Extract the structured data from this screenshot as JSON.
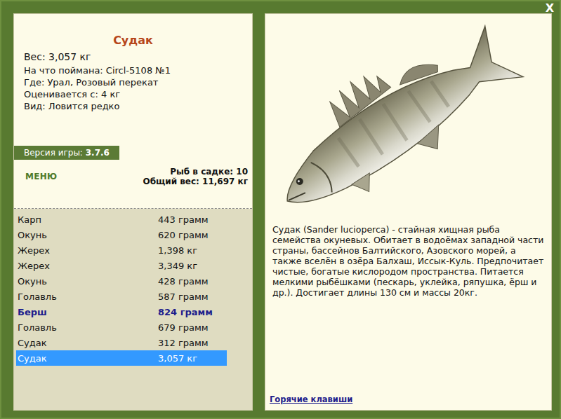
{
  "window": {
    "close": "X"
  },
  "fish": {
    "title": "Судак",
    "info": [
      "Вес: 3,057 кг",
      "На что поймана: Circl-5108 №1",
      "Где: Урал, Розовый перекат",
      "Оценивается с: 4 кг",
      "Вид: Ловится редко"
    ]
  },
  "version": {
    "label": "Версия игры: ",
    "value": "3.7.6"
  },
  "menu": "МЕНЮ",
  "summary": [
    "Рыб в садке: 10",
    "Общий вес: 11,697 кг"
  ],
  "catch": [
    {
      "name": "Карп",
      "weight": "443 грамм",
      "highlighted": false,
      "selected": false
    },
    {
      "name": "Окунь",
      "weight": "620 грамм",
      "highlighted": false,
      "selected": false
    },
    {
      "name": "Жерех",
      "weight": "1,398 кг",
      "highlighted": false,
      "selected": false
    },
    {
      "name": "Жерех",
      "weight": "3,349 кг",
      "highlighted": false,
      "selected": false
    },
    {
      "name": "Окунь",
      "weight": "428 грамм",
      "highlighted": false,
      "selected": false
    },
    {
      "name": "Голавль",
      "weight": "587 грамм",
      "highlighted": false,
      "selected": false
    },
    {
      "name": "Берш",
      "weight": "824 грамм",
      "highlighted": true,
      "selected": false
    },
    {
      "name": "Голавль",
      "weight": "679 грамм",
      "highlighted": false,
      "selected": false
    },
    {
      "name": "Судак",
      "weight": "312 грамм",
      "highlighted": false,
      "selected": false
    },
    {
      "name": "Судак",
      "weight": "3,057 кг",
      "highlighted": false,
      "selected": true
    }
  ],
  "description": "Судак (Sander lucioperca) - стайная хищная рыба семейства окуневых. Обитает в водоёмах западной части страны, бассейнов Балтийского, Азовского морей, а также вселён в озёра Балхаш, Иссык-Куль. Предпочитает чистые, богатые кислородом пространства. Питается мелкими рыбёшками (пескарь, уклейка, ряпушка, ёрш и др.). Достигает длины 130 см и массы 20кг.",
  "hotkeys": "Горячие клавиши"
}
